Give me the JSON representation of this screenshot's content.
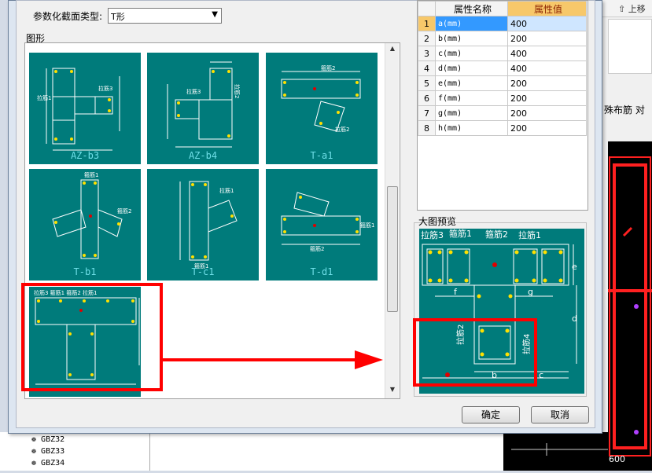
{
  "background": {
    "up_button": "上移",
    "right_label": "殊布筋 对",
    "canvas_value": "600",
    "tree_items": [
      "GBZ32",
      "GBZ33",
      "GBZ34"
    ]
  },
  "dialog": {
    "type_label": "参数化截面类型:",
    "type_value": "T形",
    "figure_label": "图形",
    "thumbnails": [
      "AZ-b3",
      "AZ-b4",
      "T-a1",
      "T-b1",
      "T-c1",
      "T-d1",
      ""
    ],
    "preview_label": "大图预览",
    "ok_label": "确定",
    "cancel_label": "取消"
  },
  "properties": {
    "headers": [
      "属性名称",
      "属性值"
    ],
    "rows": [
      {
        "idx": "1",
        "name": "a(mm)",
        "value": "400"
      },
      {
        "idx": "2",
        "name": "b(mm)",
        "value": "200"
      },
      {
        "idx": "3",
        "name": "c(mm)",
        "value": "400"
      },
      {
        "idx": "4",
        "name": "d(mm)",
        "value": "400"
      },
      {
        "idx": "5",
        "name": "e(mm)",
        "value": "200"
      },
      {
        "idx": "6",
        "name": "f(mm)",
        "value": "200"
      },
      {
        "idx": "7",
        "name": "g(mm)",
        "value": "200"
      },
      {
        "idx": "8",
        "name": "h(mm)",
        "value": "200"
      }
    ]
  },
  "preview_labels": {
    "l1": "拉筋3",
    "l2": "箍筋1",
    "l3": "箍筋2",
    "l4": "拉筋1",
    "e": "e",
    "f": "f",
    "g": "g",
    "d": "d",
    "b": "b",
    "c": "c",
    "l5": "拉筋2",
    "l6": "拉筋4"
  },
  "colors": {
    "teal": "#007b7b",
    "annotation": "#ff0000",
    "selected": "#3399ff"
  }
}
